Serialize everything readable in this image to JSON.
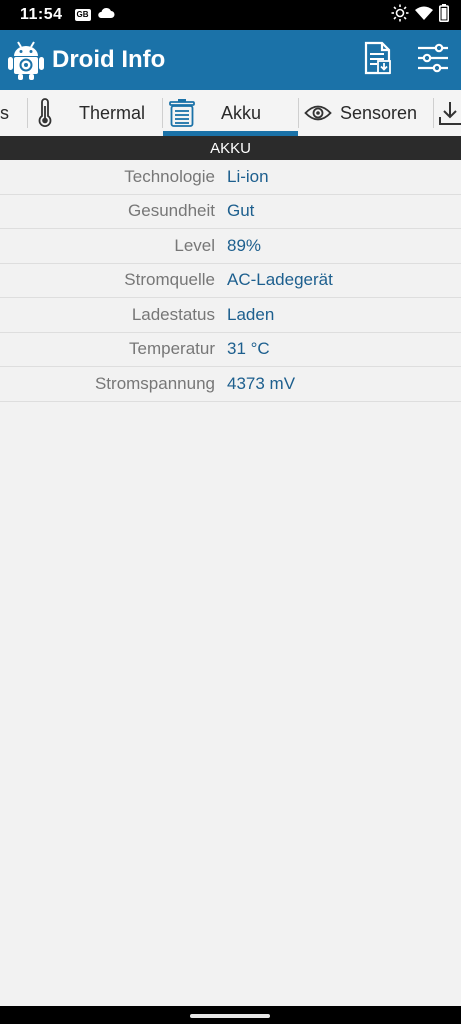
{
  "status": {
    "time": "11:54",
    "badge": "GB"
  },
  "appbar": {
    "title": "Droid Info"
  },
  "tabs": [
    {
      "label": "s"
    },
    {
      "label": "Thermal"
    },
    {
      "label": "Akku"
    },
    {
      "label": "Sensoren"
    }
  ],
  "section": {
    "title": "AKKU"
  },
  "rows": [
    {
      "key": "Technologie",
      "value": "Li-ion"
    },
    {
      "key": "Gesundheit",
      "value": "Gut"
    },
    {
      "key": "Level",
      "value": "89%"
    },
    {
      "key": "Stromquelle",
      "value": "AC-Ladegerät"
    },
    {
      "key": "Ladestatus",
      "value": "Laden"
    },
    {
      "key": "Temperatur",
      "value": "31 °C"
    },
    {
      "key": "Stromspannung",
      "value": "4373 mV"
    }
  ],
  "colors": {
    "appbar": "#1b72a8",
    "value_text": "#1d5f8e",
    "indicator": "#1b72a8"
  },
  "icons": [
    "cloud-icon",
    "brightness-icon",
    "wifi-icon",
    "battery-icon",
    "report-icon",
    "settings-sliders-icon",
    "thermometer-icon",
    "battery-tab-icon",
    "eye-icon",
    "download-icon"
  ]
}
